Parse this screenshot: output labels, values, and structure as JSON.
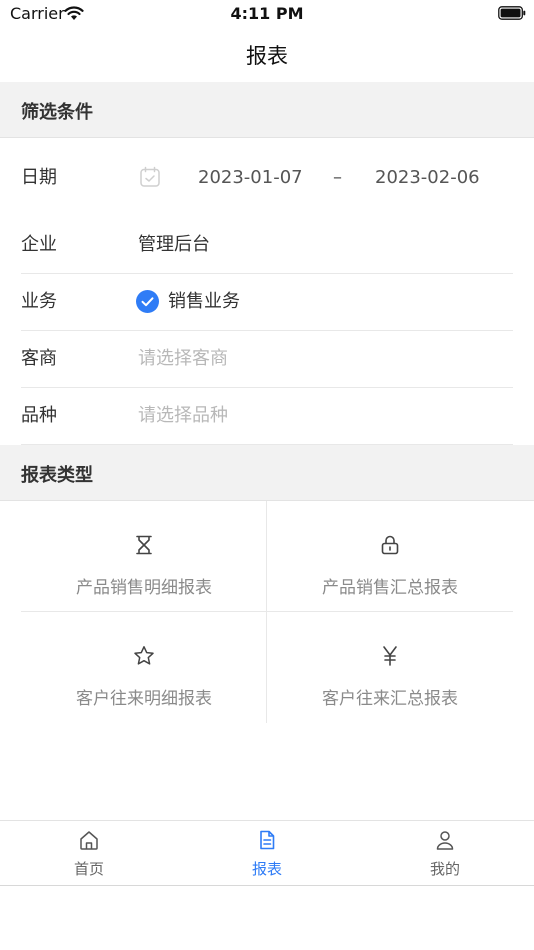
{
  "status_bar": {
    "carrier": "Carrier",
    "time": "4:11 PM"
  },
  "nav": {
    "title": "报表"
  },
  "filter_section": {
    "title": "筛选条件"
  },
  "filters": {
    "date": {
      "label": "日期",
      "start": "2023-01-07",
      "separator": "–",
      "end": "2023-02-06"
    },
    "company": {
      "label": "企业",
      "value": "管理后台"
    },
    "business": {
      "label": "业务",
      "value": "销售业务",
      "checked": true
    },
    "customer": {
      "label": "客商",
      "placeholder": "请选择客商"
    },
    "variety": {
      "label": "品种",
      "placeholder": "请选择品种"
    }
  },
  "report_section": {
    "title": "报表类型"
  },
  "reports": [
    {
      "label": "产品销售明细报表",
      "icon": "hourglass-icon"
    },
    {
      "label": "产品销售汇总报表",
      "icon": "lock-icon"
    },
    {
      "label": "客户往来明细报表",
      "icon": "star-icon"
    },
    {
      "label": "客户往来汇总报表",
      "icon": "yen-icon"
    }
  ],
  "tabs": [
    {
      "label": "首页",
      "icon": "home-icon",
      "active": false
    },
    {
      "label": "报表",
      "icon": "document-icon",
      "active": true
    },
    {
      "label": "我的",
      "icon": "user-icon",
      "active": false
    }
  ],
  "colors": {
    "accent": "#2f7cf6",
    "section_bg": "#f2f2f2",
    "placeholder": "#b8b8b8",
    "grid_label": "#8a8a8a"
  }
}
